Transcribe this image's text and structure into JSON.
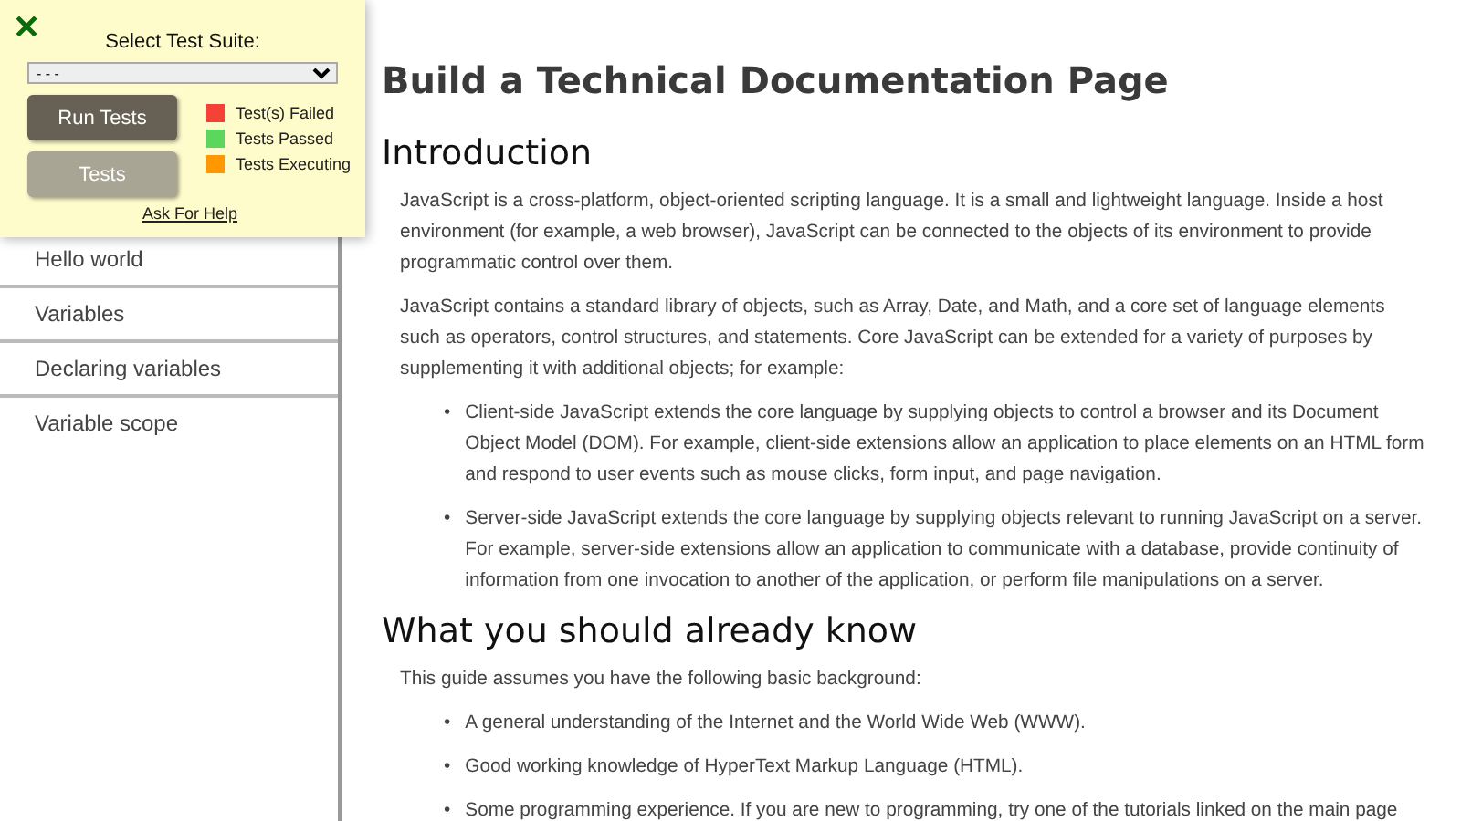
{
  "test_panel": {
    "close": "✕",
    "suite_label": "Select Test Suite:",
    "suite_value": "- - -",
    "buttons": [
      {
        "label": "Run Tests",
        "kind": "primary"
      },
      {
        "label": "Tests",
        "kind": "secondary"
      }
    ],
    "legend": [
      {
        "label": "Test(s) Failed",
        "color": "#f44336"
      },
      {
        "label": "Tests Passed",
        "color": "#5cd65c"
      },
      {
        "label": "Tests Executing",
        "color": "#ff9800"
      }
    ],
    "help_link": "Ask For Help"
  },
  "sidebar": {
    "items": [
      "Hello world",
      "Variables",
      "Declaring variables",
      "Variable scope"
    ]
  },
  "main": {
    "title": "Build a Technical Documentation Page",
    "sections": [
      {
        "heading": "Introduction",
        "blocks": [
          {
            "kind": "paragraph",
            "text": "JavaScript is a cross-platform, object-oriented scripting language. It is a small and lightweight language. Inside a host environment (for example, a web browser), JavaScript can be connected to the objects of its environment to provide programmatic control over them."
          },
          {
            "kind": "paragraph",
            "text": "JavaScript contains a standard library of objects, such as Array, Date, and Math, and a core set of language elements such as operators, control structures, and statements. Core JavaScript can be extended for a variety of purposes by supplementing it with additional objects; for example:"
          },
          {
            "kind": "list",
            "marker": "•",
            "items": [
              "Client-side JavaScript extends the core language by supplying objects to control a browser and its Document Object Model (DOM). For example, client-side extensions allow an application to place elements on an HTML form and respond to user events such as mouse clicks, form input, and page navigation.",
              "Server-side JavaScript extends the core language by supplying objects relevant to running JavaScript on a server. For example, server-side extensions allow an application to communicate with a database, provide continuity of information from one invocation to another of the application, or perform file manipulations on a server."
            ]
          }
        ]
      },
      {
        "heading": "What you should already know",
        "blocks": [
          {
            "kind": "paragraph",
            "text": "This guide assumes you have the following basic background:"
          },
          {
            "kind": "list",
            "marker": "•",
            "items": [
              "A general understanding of the Internet and the World Wide Web (WWW).",
              "Good working knowledge of HyperText Markup Language (HTML).",
              "Some programming experience. If you are new to programming, try one of the tutorials linked on the main page"
            ]
          }
        ]
      }
    ]
  }
}
